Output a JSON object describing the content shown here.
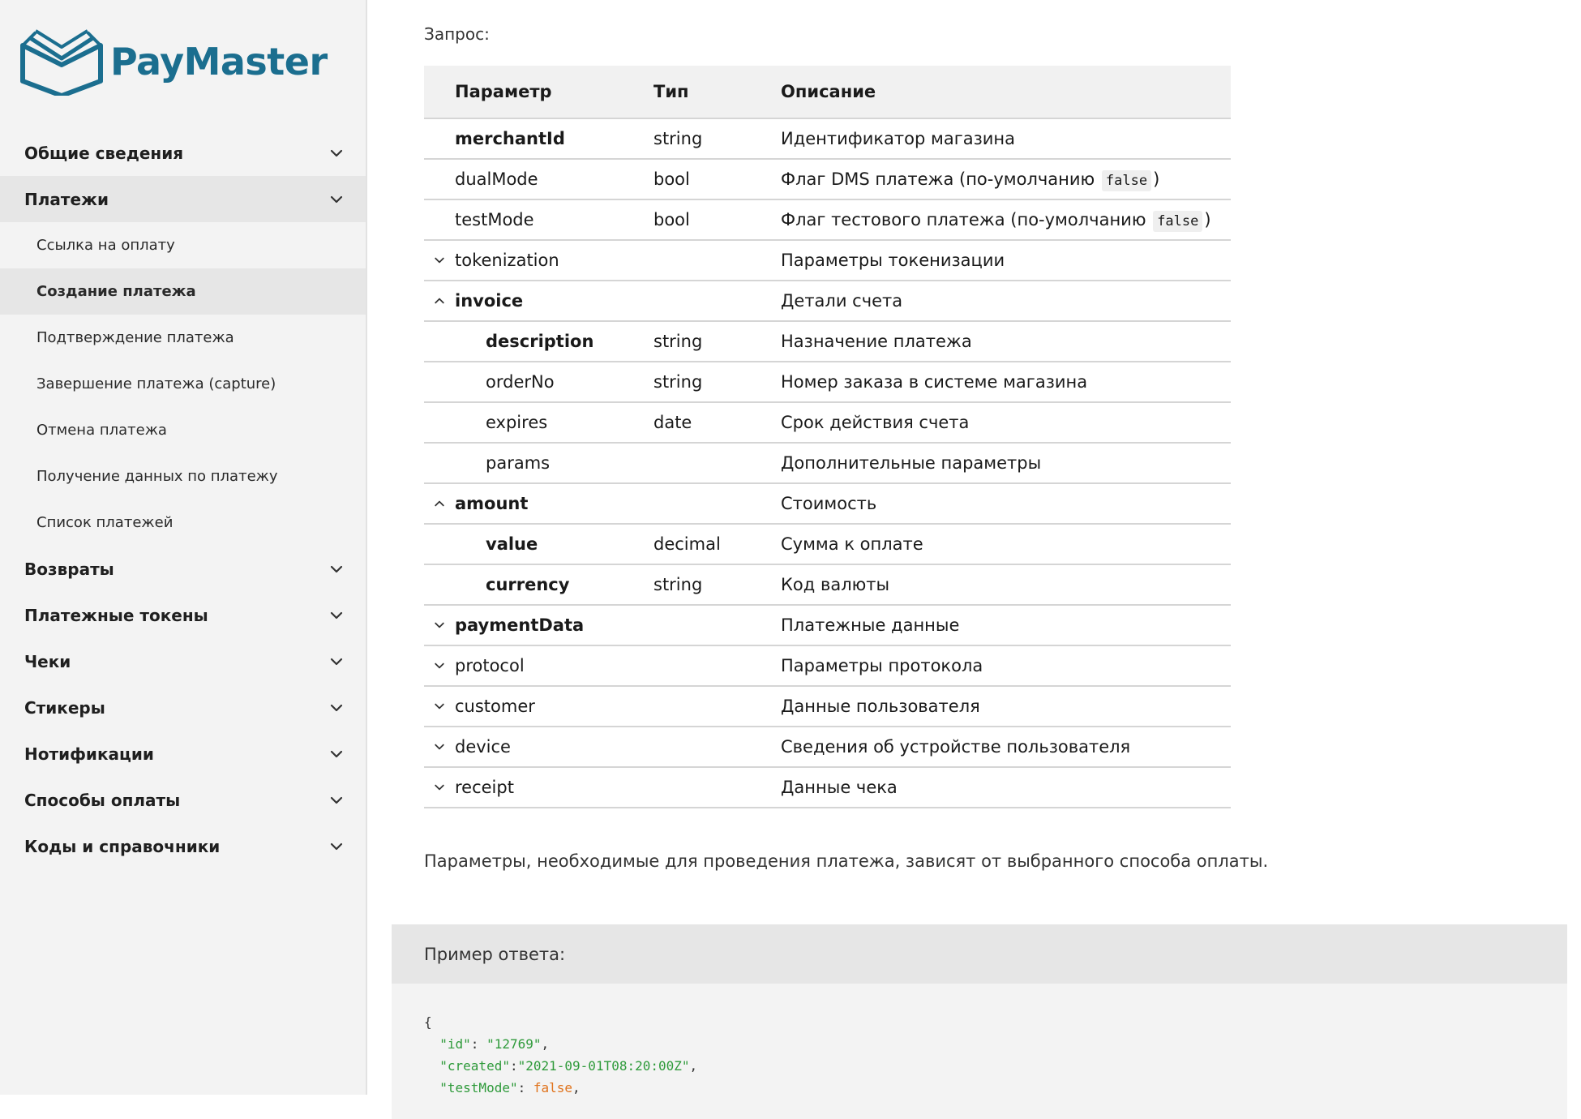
{
  "brand": {
    "name": "PayMaster",
    "color": "#1b6e8f"
  },
  "nav": [
    {
      "label": "Общие сведения"
    },
    {
      "label": "Платежи",
      "expanded": true,
      "children": [
        {
          "label": "Ссылка на оплату"
        },
        {
          "label": "Создание платежа",
          "active": true
        },
        {
          "label": "Подтверждение платежа"
        },
        {
          "label": "Завершение платежа (capture)"
        },
        {
          "label": "Отмена платежа"
        },
        {
          "label": "Получение данных по платежу"
        },
        {
          "label": "Список платежей"
        }
      ]
    },
    {
      "label": "Возвраты"
    },
    {
      "label": "Платежные токены"
    },
    {
      "label": "Чеки"
    },
    {
      "label": "Стикеры"
    },
    {
      "label": "Нотификации"
    },
    {
      "label": "Способы оплаты"
    },
    {
      "label": "Коды и справочники"
    }
  ],
  "request": {
    "title": "Запрос:",
    "columns": [
      "Параметр",
      "Тип",
      "Описание"
    ],
    "rows": [
      {
        "name": "merchantId",
        "type": "string",
        "desc": "Идентификатор магазина",
        "bold": true
      },
      {
        "name": "dualMode",
        "type": "bool",
        "desc_before": "Флаг DMS платежа (по-умолчанию",
        "code": "false",
        "desc_after": ")"
      },
      {
        "name": "testMode",
        "type": "bool",
        "desc_before": "Флаг тестового платежа (по-умолчанию",
        "code": "false",
        "desc_after": ")"
      },
      {
        "name": "tokenization",
        "type": "",
        "desc": "Параметры токенизации",
        "toggle": "collapsed"
      },
      {
        "name": "invoice",
        "type": "",
        "desc": "Детали счета",
        "toggle": "expanded",
        "bold": true
      },
      {
        "name": "description",
        "type": "string",
        "desc": "Назначение платежа",
        "nested": true,
        "bold": true
      },
      {
        "name": "orderNo",
        "type": "string",
        "desc": "Номер заказа в системе магазина",
        "nested": true
      },
      {
        "name": "expires",
        "type": "date",
        "desc": "Срок действия счета",
        "nested": true
      },
      {
        "name": "params",
        "type": "",
        "desc": "Дополнительные параметры",
        "nested": true
      },
      {
        "name": "amount",
        "type": "",
        "desc": "Стоимость",
        "toggle": "expanded",
        "bold": true
      },
      {
        "name": "value",
        "type": "decimal",
        "desc": "Сумма к оплате",
        "nested": true,
        "bold": true
      },
      {
        "name": "currency",
        "type": "string",
        "desc": "Код валюты",
        "nested": true,
        "bold": true
      },
      {
        "name": "paymentData",
        "type": "",
        "desc": "Платежные данные",
        "toggle": "collapsed",
        "bold": true
      },
      {
        "name": "protocol",
        "type": "",
        "desc": "Параметры протокола",
        "toggle": "collapsed"
      },
      {
        "name": "customer",
        "type": "",
        "desc": "Данные пользователя",
        "toggle": "collapsed"
      },
      {
        "name": "device",
        "type": "",
        "desc": "Сведения об устройстве пользователя",
        "toggle": "collapsed"
      },
      {
        "name": "receipt",
        "type": "",
        "desc": "Данные чека",
        "toggle": "collapsed"
      }
    ],
    "note": "Параметры, необходимые для проведения платежа, зависят от выбранного способа оплаты."
  },
  "response": {
    "title": "Пример ответа:",
    "code_lines": [
      {
        "parts": [
          {
            "t": "{",
            "c": ""
          }
        ]
      },
      {
        "parts": [
          {
            "t": "  ",
            "c": ""
          },
          {
            "t": "\"id\"",
            "c": "k"
          },
          {
            "t": ": ",
            "c": ""
          },
          {
            "t": "\"12769\"",
            "c": "s"
          },
          {
            "t": ",",
            "c": ""
          }
        ]
      },
      {
        "parts": [
          {
            "t": "  ",
            "c": ""
          },
          {
            "t": "\"created\"",
            "c": "k"
          },
          {
            "t": ":",
            "c": ""
          },
          {
            "t": "\"2021-09-01T08:20:00Z\"",
            "c": "s"
          },
          {
            "t": ",",
            "c": ""
          }
        ]
      },
      {
        "parts": [
          {
            "t": "  ",
            "c": ""
          },
          {
            "t": "\"testMode\"",
            "c": "k"
          },
          {
            "t": ": ",
            "c": ""
          },
          {
            "t": "false",
            "c": "f"
          },
          {
            "t": ",",
            "c": ""
          }
        ]
      }
    ]
  }
}
